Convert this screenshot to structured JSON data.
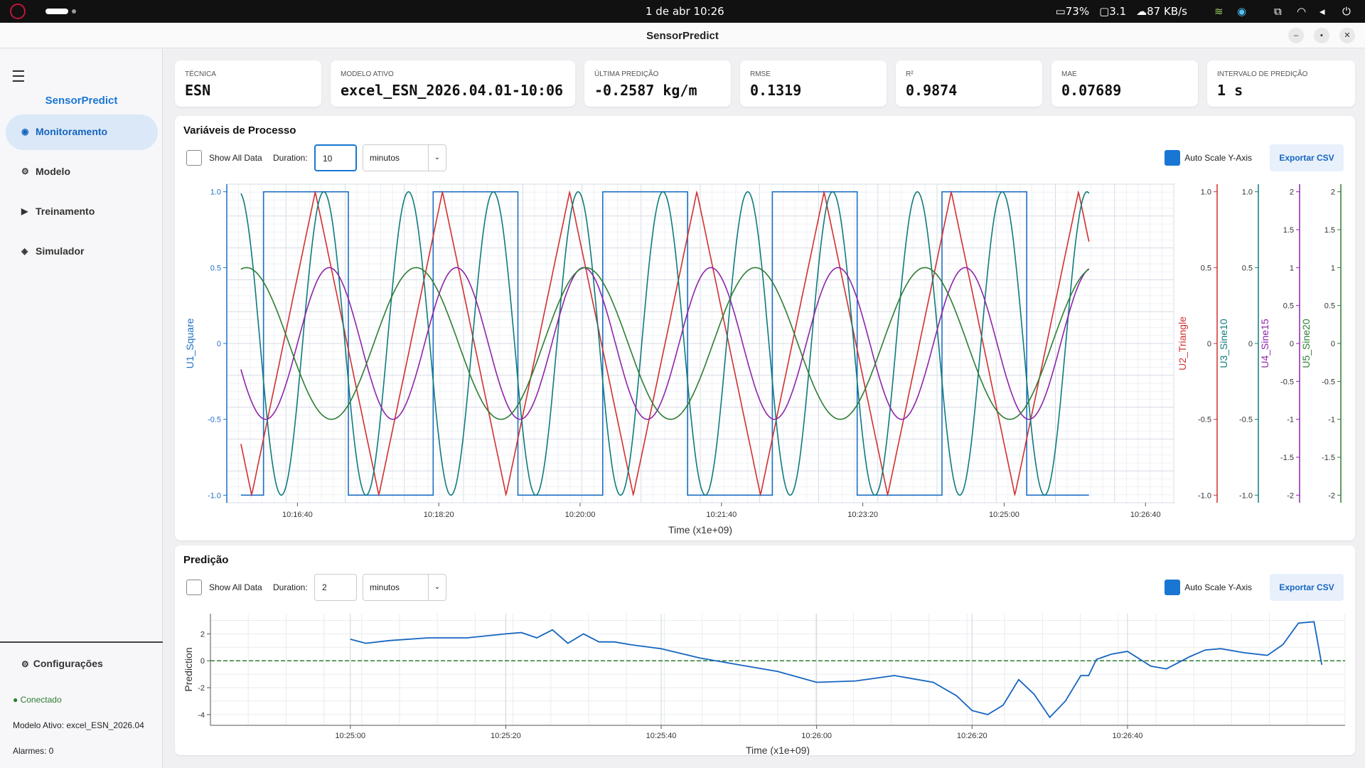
{
  "system": {
    "clock": "1 de abr  10:26",
    "battery": "73%",
    "display": "3.1",
    "network": "87 KB/s"
  },
  "window": {
    "title": "SensorPredict"
  },
  "sidebar": {
    "brand": "SensorPredict",
    "items": [
      {
        "label": "Monitoramento",
        "icon": "radio-icon",
        "active": true
      },
      {
        "label": "Modelo",
        "icon": "gear-icon"
      },
      {
        "label": "Treinamento",
        "icon": "play-icon"
      },
      {
        "label": "Simulador",
        "icon": "diamond-icon"
      }
    ],
    "config_label": "Configurações",
    "status": "Conectado",
    "model_active": "Modelo Ativo: excel_ESN_2026.04",
    "alarms": "Alarmes: 0"
  },
  "cards": [
    {
      "label": "TÉCNICA",
      "value": "ESN"
    },
    {
      "label": "MODELO ATIVO",
      "value": "excel_ESN_2026.04.01-10:06"
    },
    {
      "label": "ÚLTIMA PREDIÇÃO",
      "value": "-0.2587 kg/m"
    },
    {
      "label": "RMSE",
      "value": "0.1319"
    },
    {
      "label": "R²",
      "value": "0.9874"
    },
    {
      "label": "MAE",
      "value": "0.07689"
    },
    {
      "label": "INTERVALO DE PREDIÇÃO",
      "value": "1 s"
    }
  ],
  "process_panel": {
    "title": "Variáveis de Processo",
    "show_all_label": "Show All Data",
    "duration_label": "Duration:",
    "duration_value": "10",
    "unit": "minutos",
    "auto_scale_label": "Auto Scale Y-Axis",
    "export_label": "Exportar CSV"
  },
  "prediction_panel": {
    "title": "Predição",
    "show_all_label": "Show All Data",
    "duration_label": "Duration:",
    "duration_value": "2",
    "unit": "minutos",
    "auto_scale_label": "Auto Scale Y-Axis",
    "export_label": "Exportar CSV"
  },
  "chart_data": [
    {
      "type": "line",
      "title": "",
      "xlabel": "Time (x1e+09)",
      "x_ticks": [
        "10:16:40",
        "10:18:20",
        "10:20:00",
        "10:21:40",
        "10:23:20",
        "10:25:00",
        "10:26:40"
      ],
      "axes": [
        {
          "name": "U1_Square",
          "color": "#1f6fc5",
          "ticks": [
            "1.0",
            "0.5",
            "0",
            "-0.5",
            "-1.0"
          ],
          "ylim": [
            -1.05,
            1.05
          ]
        },
        {
          "name": "U2_Triangle",
          "color": "#d32f2f",
          "ticks": [
            "1.0",
            "0.5",
            "0",
            "-0.5",
            "-1.0"
          ],
          "ylim": [
            -1.05,
            1.05
          ]
        },
        {
          "name": "U3_Sine10",
          "color": "#0f7b7b",
          "ticks": [
            "1.0",
            "0.5",
            "0",
            "-0.5",
            "-1.0"
          ],
          "ylim": [
            -1.05,
            1.05
          ]
        },
        {
          "name": "U4_Sine15",
          "color": "#8e24aa",
          "ticks": [
            "2",
            "1.5",
            "1",
            "0.5",
            "0",
            "-0.5",
            "-1",
            "-1.5",
            "-2"
          ],
          "ylim": [
            -2.1,
            2.1
          ]
        },
        {
          "name": "U5_Sine20",
          "color": "#2e7d32",
          "ticks": [
            "2",
            "1.5",
            "1",
            "0.5",
            "0",
            "-0.5",
            "-1",
            "-1.5",
            "-2"
          ],
          "ylim": [
            -2.1,
            2.1
          ]
        }
      ],
      "series": [
        {
          "name": "U1_Square",
          "type": "square",
          "amplitude": 1,
          "period_s": 120,
          "color": "#1f6fc5"
        },
        {
          "name": "U2_Triangle",
          "type": "triangle",
          "amplitude": 1,
          "period_s": 90,
          "color": "#d32f2f"
        },
        {
          "name": "U3_Sine10",
          "type": "sine",
          "amplitude": 1,
          "period_s": 60,
          "color": "#0f7b7b"
        },
        {
          "name": "U4_Sine15",
          "type": "sine",
          "amplitude": 1,
          "period_s": 90,
          "color": "#8e24aa"
        },
        {
          "name": "U5_Sine20",
          "type": "sine",
          "amplitude": 1,
          "period_s": 120,
          "color": "#2e7d32"
        }
      ]
    },
    {
      "type": "line",
      "title": "",
      "xlabel": "Time (x1e+09)",
      "ylabel": "Prediction",
      "x_ticks": [
        "10:25:00",
        "10:25:20",
        "10:25:40",
        "10:26:00",
        "10:26:20",
        "10:26:40"
      ],
      "y_ticks": [
        "2",
        "0",
        "-2",
        "-4"
      ],
      "ylim": [
        -4.8,
        3.5
      ],
      "reference_line": 0,
      "series": [
        {
          "name": "Prediction",
          "color": "#1565c0",
          "x": [
            0,
            2,
            5,
            10,
            15,
            20,
            22,
            24,
            26,
            28,
            30,
            32,
            34,
            36,
            40,
            45,
            50,
            55,
            60,
            65,
            70,
            75,
            78,
            80,
            82,
            84,
            86,
            88,
            90,
            92,
            94,
            95,
            96,
            97,
            98,
            100,
            103,
            105,
            108,
            110,
            112,
            115,
            118,
            120,
            122,
            124,
            125
          ],
          "y": [
            1.6,
            1.3,
            1.5,
            1.7,
            1.7,
            2.0,
            2.1,
            1.7,
            2.3,
            1.3,
            2.0,
            1.4,
            1.4,
            1.2,
            0.9,
            0.2,
            -0.3,
            -0.8,
            -1.6,
            -1.5,
            -1.1,
            -1.6,
            -2.6,
            -3.7,
            -4.0,
            -3.3,
            -1.4,
            -2.5,
            -4.2,
            -3.0,
            -1.1,
            -1.1,
            0.1,
            0.3,
            0.5,
            0.7,
            -0.4,
            -0.6,
            0.3,
            0.8,
            0.9,
            0.6,
            0.4,
            1.2,
            2.8,
            2.9,
            -0.3
          ]
        }
      ]
    }
  ]
}
